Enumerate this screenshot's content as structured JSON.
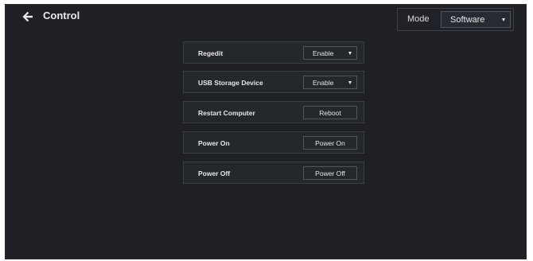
{
  "header": {
    "title": "Control",
    "back_icon": "arrow-left-icon"
  },
  "mode": {
    "label": "Mode",
    "selected": "Software"
  },
  "settings": {
    "regedit": {
      "label": "Regedit",
      "value": "Enable"
    },
    "usb_storage": {
      "label": "USB Storage Device",
      "value": "Enable"
    },
    "restart": {
      "label": "Restart Computer",
      "button": "Reboot"
    },
    "power_on": {
      "label": "Power On",
      "button": "Power On"
    },
    "power_off": {
      "label": "Power Off",
      "button": "Power Off"
    }
  },
  "colors": {
    "background": "#1e2025",
    "row_background": "#24272c",
    "border": "#3a3e45",
    "text": "#e6e7e9"
  }
}
